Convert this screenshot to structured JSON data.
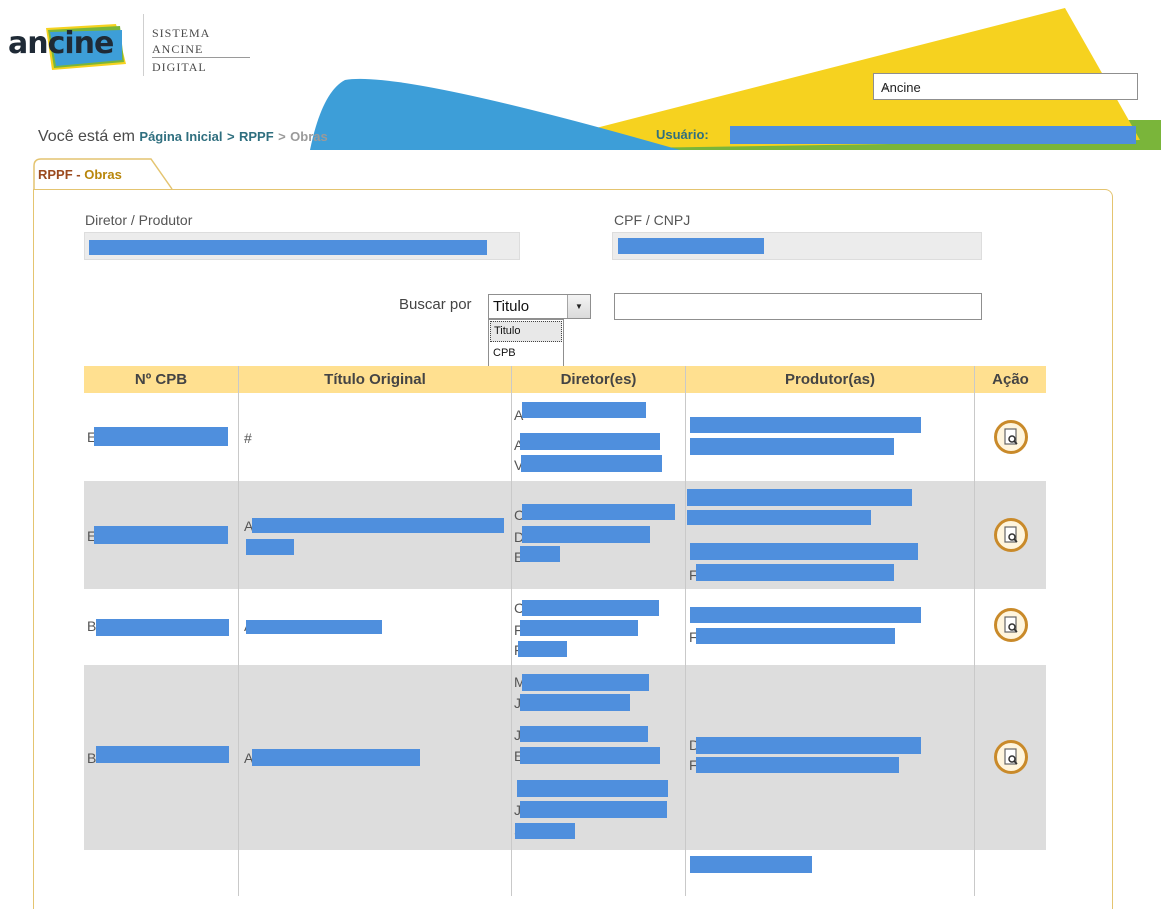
{
  "header": {
    "logo": "ancine",
    "system_name": [
      "SISTEMA",
      "ANCINE",
      "DIGITAL"
    ],
    "org_select": {
      "value": "Ancine"
    },
    "breadcrumb": {
      "prefix": "Você está em",
      "items": [
        "Página Inicial",
        "RPPF",
        "Obras"
      ],
      "separator": ">"
    },
    "user_label": "Usuário:",
    "colors": {
      "yellow": "#f6d21f",
      "blue": "#3d9ed8",
      "green": "#7ab53a",
      "teal": "#2f6f7f"
    }
  },
  "tab": {
    "part1": "RPPF",
    "sep": " - ",
    "part2": "Obras"
  },
  "form": {
    "director_label": "Diretor / Produtor",
    "cpf_label": "CPF / CNPJ",
    "search_label": "Buscar por",
    "search_select_value": "Titulo",
    "search_options": [
      "Titulo",
      "CPB"
    ],
    "search_input_value": ""
  },
  "table": {
    "headers": [
      "Nº CPB",
      "Título Original",
      "Diretor(es)",
      "Produtor(as)",
      "Ação"
    ],
    "rows": [
      {
        "cpb": "E",
        "titulo": "#",
        "diretores": [
          "A",
          "A",
          "V"
        ],
        "produtores": [
          "",
          ""
        ]
      },
      {
        "cpb": "E",
        "titulo": "A",
        "diretores": [
          "C",
          "D",
          "E"
        ],
        "produtores": [
          "",
          "",
          "",
          "F"
        ]
      },
      {
        "cpb": "B",
        "titulo": "A",
        "diretores": [
          "C",
          "F",
          "F"
        ],
        "produtores": [
          "",
          "F"
        ]
      },
      {
        "cpb": "B",
        "titulo": "A",
        "diretores": [
          "M",
          "J",
          "J",
          "E",
          "J",
          "S"
        ],
        "produtores": [
          "D",
          "F"
        ]
      }
    ],
    "action_icon": "view-document-icon"
  }
}
